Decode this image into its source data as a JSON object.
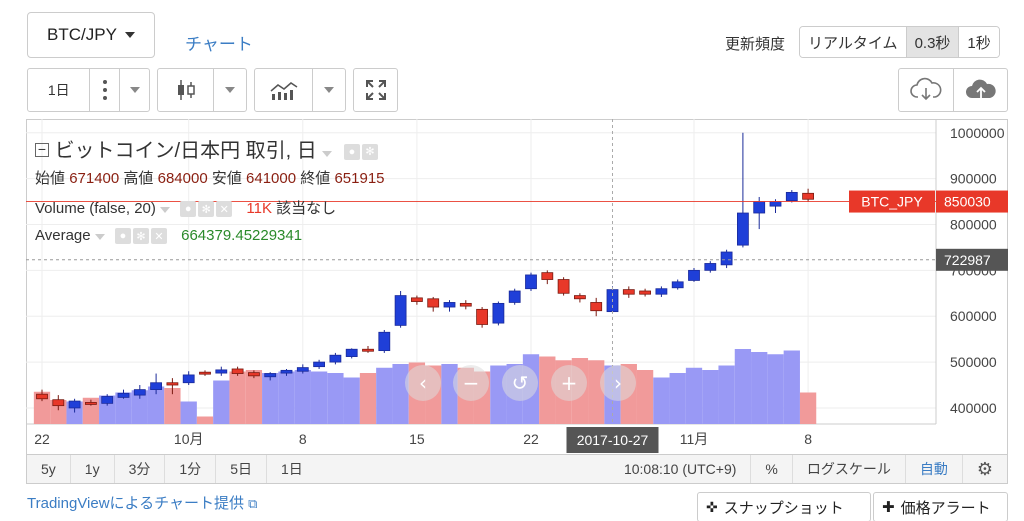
{
  "header": {
    "pair_label": "BTC/JPY",
    "chart_link": "チャート",
    "update_rate_label": "更新頻度",
    "rate_options": [
      "リアルタイム",
      "0.3秒",
      "1秒"
    ],
    "rate_selected_index": 1
  },
  "toolbar": {
    "interval_label": "1日"
  },
  "legend": {
    "title": "ビットコイン/日本円 取引, 日",
    "ohlc": [
      {
        "label": "始値",
        "value": "671400"
      },
      {
        "label": "高値",
        "value": "684000"
      },
      {
        "label": "安値",
        "value": "641000"
      },
      {
        "label": "終値",
        "value": "651915"
      }
    ],
    "volume_label": "Volume (false, 20)",
    "volume_value": "11K",
    "volume_extra": "該当なし",
    "average_label": "Average",
    "average_value": "664379.45229341"
  },
  "chart_data": {
    "type": "candlestick",
    "series_name": "BTC_JPY",
    "y_ticks": [
      400000,
      500000,
      600000,
      700000,
      800000,
      900000,
      1000000
    ],
    "y_tick_labels": [
      "400000",
      "500000",
      "600000",
      "700000",
      "800000",
      "900000",
      "1000000"
    ],
    "ylim": [
      365000,
      1030000
    ],
    "x_tick_labels": [
      "22",
      "10月",
      "8",
      "15",
      "22",
      "11月",
      "8"
    ],
    "x_tick_days": [
      0,
      9,
      16,
      23,
      30,
      40,
      47
    ],
    "x_hover_label": "2017-10-27",
    "hover_day": 35,
    "last_price_label": "850030",
    "average_line_label": "722987",
    "average_line_value": 722987,
    "last_price_value": 850030,
    "candles": [
      {
        "o": 430000,
        "h": 440000,
        "l": 415000,
        "c": 420000
      },
      {
        "o": 418000,
        "h": 428000,
        "l": 395000,
        "c": 405000
      },
      {
        "o": 400000,
        "h": 420000,
        "l": 390000,
        "c": 415000
      },
      {
        "o": 412000,
        "h": 418000,
        "l": 405000,
        "c": 408000
      },
      {
        "o": 410000,
        "h": 430000,
        "l": 405000,
        "c": 425000
      },
      {
        "o": 423000,
        "h": 440000,
        "l": 420000,
        "c": 432000
      },
      {
        "o": 428000,
        "h": 450000,
        "l": 420000,
        "c": 440000
      },
      {
        "o": 440000,
        "h": 475000,
        "l": 430000,
        "c": 455000
      },
      {
        "o": 455000,
        "h": 465000,
        "l": 430000,
        "c": 450000
      },
      {
        "o": 455000,
        "h": 480000,
        "l": 450000,
        "c": 472000
      },
      {
        "o": 478000,
        "h": 482000,
        "l": 470000,
        "c": 476000
      },
      {
        "o": 476000,
        "h": 490000,
        "l": 470000,
        "c": 483000
      },
      {
        "o": 485000,
        "h": 490000,
        "l": 470000,
        "c": 475000
      },
      {
        "o": 477000,
        "h": 482000,
        "l": 465000,
        "c": 470000
      },
      {
        "o": 468000,
        "h": 478000,
        "l": 460000,
        "c": 475000
      },
      {
        "o": 476000,
        "h": 485000,
        "l": 470000,
        "c": 482000
      },
      {
        "o": 480000,
        "h": 495000,
        "l": 475000,
        "c": 488000
      },
      {
        "o": 490000,
        "h": 505000,
        "l": 485000,
        "c": 500000
      },
      {
        "o": 500000,
        "h": 520000,
        "l": 495000,
        "c": 515000
      },
      {
        "o": 512000,
        "h": 530000,
        "l": 508000,
        "c": 528000
      },
      {
        "o": 528000,
        "h": 535000,
        "l": 520000,
        "c": 526000
      },
      {
        "o": 525000,
        "h": 570000,
        "l": 520000,
        "c": 565000
      },
      {
        "o": 580000,
        "h": 655000,
        "l": 575000,
        "c": 645000
      },
      {
        "o": 640000,
        "h": 645000,
        "l": 625000,
        "c": 632000
      },
      {
        "o": 638000,
        "h": 642000,
        "l": 610000,
        "c": 620000
      },
      {
        "o": 620000,
        "h": 635000,
        "l": 610000,
        "c": 630000
      },
      {
        "o": 628000,
        "h": 635000,
        "l": 615000,
        "c": 622000
      },
      {
        "o": 615000,
        "h": 620000,
        "l": 575000,
        "c": 582000
      },
      {
        "o": 585000,
        "h": 632000,
        "l": 580000,
        "c": 628000
      },
      {
        "o": 630000,
        "h": 660000,
        "l": 625000,
        "c": 655000
      },
      {
        "o": 660000,
        "h": 695000,
        "l": 655000,
        "c": 690000
      },
      {
        "o": 695000,
        "h": 700000,
        "l": 670000,
        "c": 680000
      },
      {
        "o": 680000,
        "h": 685000,
        "l": 645000,
        "c": 650000
      },
      {
        "o": 645000,
        "h": 650000,
        "l": 630000,
        "c": 638000
      },
      {
        "o": 630000,
        "h": 640000,
        "l": 600000,
        "c": 612000
      },
      {
        "o": 610000,
        "h": 665000,
        "l": 605000,
        "c": 658000
      },
      {
        "o": 658000,
        "h": 665000,
        "l": 640000,
        "c": 648000
      },
      {
        "o": 655000,
        "h": 660000,
        "l": 643000,
        "c": 648000
      },
      {
        "o": 648000,
        "h": 665000,
        "l": 642000,
        "c": 660000
      },
      {
        "o": 662000,
        "h": 680000,
        "l": 658000,
        "c": 675000
      },
      {
        "o": 678000,
        "h": 705000,
        "l": 675000,
        "c": 700000
      },
      {
        "o": 700000,
        "h": 720000,
        "l": 695000,
        "c": 715000
      },
      {
        "o": 712000,
        "h": 745000,
        "l": 705000,
        "c": 740000
      },
      {
        "o": 755000,
        "h": 1000000,
        "l": 750000,
        "c": 825000
      },
      {
        "o": 825000,
        "h": 860000,
        "l": 790000,
        "c": 850000
      },
      {
        "o": 840000,
        "h": 855000,
        "l": 825000,
        "c": 850000
      },
      {
        "o": 852000,
        "h": 875000,
        "l": 848000,
        "c": 870000
      },
      {
        "o": 868000,
        "h": 878000,
        "l": 850000,
        "c": 855000
      }
    ],
    "volumes": [
      0.43,
      0.32,
      0.3,
      0.35,
      0.38,
      0.42,
      0.45,
      0.5,
      0.48,
      0.3,
      0.1,
      0.58,
      0.7,
      0.72,
      0.68,
      0.7,
      0.72,
      0.7,
      0.68,
      0.62,
      0.68,
      0.75,
      0.8,
      0.82,
      0.78,
      0.8,
      0.75,
      0.7,
      0.78,
      0.8,
      0.93,
      0.9,
      0.85,
      0.88,
      0.85,
      0.78,
      0.8,
      0.72,
      0.62,
      0.68,
      0.75,
      0.72,
      0.78,
      1.0,
      0.96,
      0.93,
      0.98,
      0.42
    ]
  },
  "nav_buttons": [
    "‹",
    "−",
    "↺",
    "+",
    "›"
  ],
  "bottom_bar": {
    "ranges": [
      "5y",
      "1y",
      "3分",
      "1分",
      "5日",
      "1日"
    ],
    "time": "10:08:10 (UTC+9)",
    "percent": "%",
    "log_scale": "ログスケール",
    "auto": "自動"
  },
  "footer": {
    "tv_link": "TradingViewによるチャート提供",
    "snapshot": "スナップショット",
    "price_alert": "価格アラート"
  },
  "colors": {
    "up": "#1f3fd8",
    "down": "#e83829",
    "volume_up": "#9999f5",
    "volume_down": "#f19a9a",
    "accent": "#3b7dc4",
    "average_text": "#2a8a2a"
  }
}
